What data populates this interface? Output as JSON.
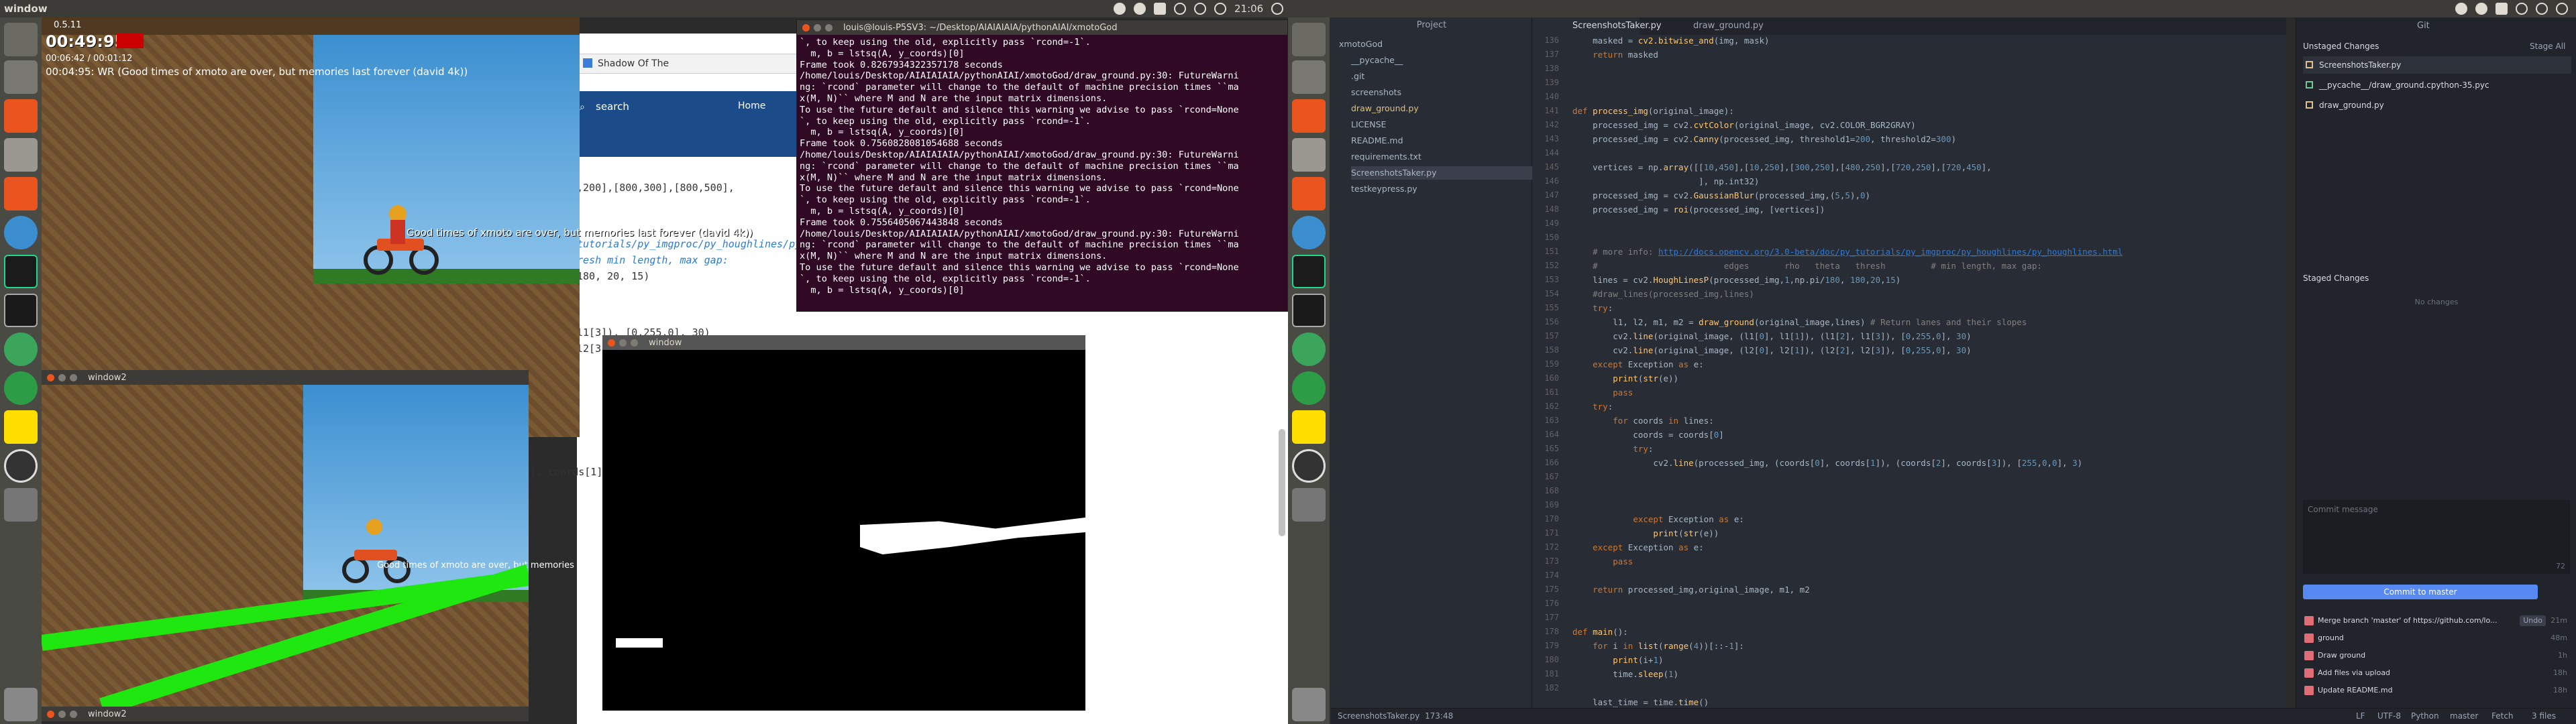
{
  "topbar": {
    "title": "window",
    "clock": "21:06"
  },
  "game": {
    "version": "0.5.11",
    "timer": "00:49:95",
    "split": "00:06:42 / 00:01:12",
    "message": "00:04:95: WR (Good times of xmoto are over, but memories last forever (david 4k))",
    "floating_text": "Good times of xmoto are over, but memories last forever (david 4k))"
  },
  "window2": {
    "title": "window2",
    "title_b": "window2"
  },
  "browser": {
    "tab_title": "Shadow Of The",
    "search_placeholder": "search",
    "nav_home": "Home",
    "code_lines": [
      ",200],[800,300],[800,500],",
      "tutorials/py_imgproc/py_houghlines/py_",
      "resh  min length, max gap:",
      "180,      20,      15)",
      "l1[3]), [0,255,0], 30)",
      "l2[3]",
      "], coords[1]"
    ]
  },
  "terminal": {
    "title": "louis@louis-P5SV3: ~/Desktop/AIAIAIAIA/pythonAIAI/xmotoGod",
    "lines": [
      "`, to keep using the old, explicitly pass `rcond=-1`.",
      "  m, b = lstsq(A, y_coords)[0]",
      "Frame took 0.8267934322357178 seconds",
      "/home/louis/Desktop/AIAIAIAIA/pythonAIAI/xmotoGod/draw_ground.py:30: FutureWarni",
      "ng: `rcond` parameter will change to the default of machine precision times ``ma",
      "x(M, N)`` where M and N are the input matrix dimensions.",
      "To use the future default and silence this warning we advise to pass `rcond=None",
      "`, to keep using the old, explicitly pass `rcond=-1`.",
      "  m, b = lstsq(A, y_coords)[0]",
      "Frame took 0.7560828081054688 seconds",
      "/home/louis/Desktop/AIAIAIAIA/pythonAIAI/xmotoGod/draw_ground.py:30: FutureWarni",
      "ng: `rcond` parameter will change to the default of machine precision times ``ma",
      "x(M, N)`` where M and N are the input matrix dimensions.",
      "To use the future default and silence this warning we advise to pass `rcond=None",
      "`, to keep using the old, explicitly pass `rcond=-1`.",
      "  m, b = lstsq(A, y_coords)[0]",
      "Frame took 0.7556405067443848 seconds",
      "/home/louis/Desktop/AIAIAIAIA/pythonAIAI/xmotoGod/draw_ground.py:30: FutureWarni",
      "ng: `rcond` parameter will change to the default of machine precision times ``ma",
      "x(M, N)`` where M and N are the input matrix dimensions.",
      "To use the future default and silence this warning we advise to pass `rcond=None",
      "`, to keep using the old, explicitly pass `rcond=-1`.",
      "  m, b = lstsq(A, y_coords)[0]",
      ""
    ]
  },
  "blackwin": {
    "title": "window"
  },
  "ide": {
    "project_header": "Project",
    "tabs": [
      "ScreenshotsTaker.py",
      "draw_ground.py"
    ],
    "tree": [
      {
        "label": "xmotoGod",
        "indent": 0
      },
      {
        "label": "__pycache__",
        "indent": 1
      },
      {
        "label": ".git",
        "indent": 1
      },
      {
        "label": "screenshots",
        "indent": 1
      },
      {
        "label": "draw_ground.py",
        "indent": 1
      },
      {
        "label": "LICENSE",
        "indent": 1
      },
      {
        "label": "README.md",
        "indent": 1
      },
      {
        "label": "requirements.txt",
        "indent": 1
      },
      {
        "label": "ScreenshotsTaker.py",
        "indent": 1
      },
      {
        "label": "testkeypress.py",
        "indent": 1
      }
    ],
    "line_numbers": [
      "136",
      "137",
      "138",
      "139",
      "140",
      "141",
      "142",
      "143",
      "144",
      "145",
      "146",
      "147",
      "148",
      "149",
      "150",
      "151",
      "152",
      "153",
      "154",
      "155",
      "156",
      "157",
      "158",
      "159",
      "160",
      "161",
      "162",
      "163",
      "164",
      "165",
      "166",
      "167",
      "168",
      "169",
      "170",
      "171",
      "172",
      "173",
      "174",
      "175",
      "176",
      "177",
      "178",
      "179",
      "180",
      "181",
      "182"
    ],
    "git_panel": {
      "title": "Git",
      "stage_all": "Stage All",
      "unstaged_header": "Unstaged Changes",
      "unstaged": [
        "ScreenshotsTaker.py",
        "__pycache__/draw_ground.cpython-35.pyc",
        "draw_ground.py"
      ],
      "staged_header": "Staged Changes",
      "no_changes": "No changes",
      "commit_placeholder": "Commit message",
      "commit_counter": "72",
      "commit_button": "Commit to master",
      "history": [
        {
          "msg": "Merge branch 'master' of https://github.com/lo...",
          "badge": "Undo",
          "time": "21m"
        },
        {
          "msg": "ground",
          "time": "48m"
        },
        {
          "msg": "Draw ground",
          "time": "1h"
        },
        {
          "msg": "Add files via upload",
          "time": "18h"
        },
        {
          "msg": "Update README.md",
          "time": "18h"
        }
      ]
    },
    "status": {
      "file": "ScreenshotsTaker.py",
      "pos": "173:48",
      "lf": "LF",
      "enc": "UTF-8",
      "lang": "Python",
      "branch": "master",
      "fetch": "Fetch",
      "files": "3 files"
    }
  }
}
